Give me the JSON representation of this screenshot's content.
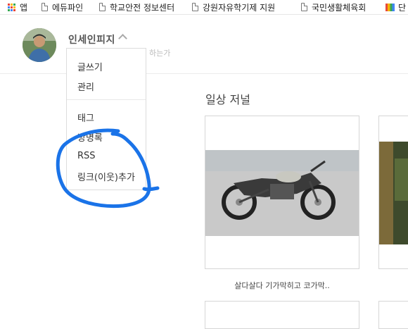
{
  "bookmarks": [
    {
      "label": "앱",
      "icon": "apps-grid-icon"
    },
    {
      "label": "에듀파인",
      "icon": "page-icon"
    },
    {
      "label": "학교안전 정보센터",
      "icon": "page-icon"
    },
    {
      "label": "강원자유학기제 지원",
      "icon": "page-icon"
    },
    {
      "label": "국민생활체육회",
      "icon": "page-icon"
    },
    {
      "label": "단",
      "icon": "colorful-icon"
    }
  ],
  "blog": {
    "name": "인세인피지",
    "subtitle": "하는가"
  },
  "menu": {
    "items": [
      "글쓰기",
      "관리",
      "태그",
      "방명록",
      "RSS",
      "링크(이웃)추가"
    ]
  },
  "content": {
    "section_title": "일상 저널",
    "post_caption": "살다살다 기가막히고 코가막.."
  },
  "colors": {
    "annotation": "#1a73e8",
    "accent": "#333333"
  }
}
